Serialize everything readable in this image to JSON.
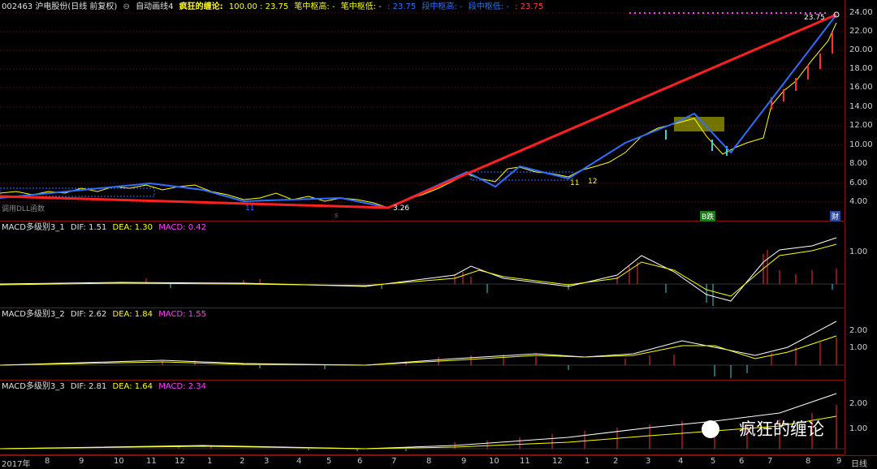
{
  "main": {
    "code_name": "002463 沪电股份(日线 前复权)",
    "indicator": "自动画线4",
    "highlight_label": "疯狂的缠论:",
    "highlight_value": "100.00 : 23.75",
    "bi_high_label": "笔中枢高: -",
    "bi_low_label": "笔中枢低: -",
    "bi_value": ": 23.75",
    "duan_high_label": "段中枢高: -",
    "duan_low_label": "段中枢低: -",
    "duan_value": ": 23.75",
    "price_last": "23.75",
    "price_low_label": "3.26",
    "label_11a": "11",
    "label_11b": "11",
    "label_12": "12",
    "dll_note": "调用DLL函数",
    "s_marker": "s",
    "chip_buy": "B跌",
    "chip_cai": "财",
    "y_ticks": [
      "24.00",
      "22.00",
      "20.00",
      "18.00",
      "16.00",
      "14.00",
      "12.00",
      "10.00",
      "8.00",
      "6.00",
      "4.00"
    ]
  },
  "macd1": {
    "name": "MACD多级别3_1",
    "dif": "DIF: 1.51",
    "dea": "DEA: 1.30",
    "macd": "MACD: 0.42",
    "tick": "1.00"
  },
  "macd2": {
    "name": "MACD多级别3_2",
    "dif": "DIF: 2.62",
    "dea": "DEA: 1.84",
    "macd": "MACD: 1.55",
    "ticks": [
      "2.00",
      "1.00"
    ]
  },
  "macd3": {
    "name": "MACD多级别3_3",
    "dif": "DIF: 2.81",
    "dea": "DEA: 1.64",
    "macd": "MACD: 2.34",
    "ticks": [
      "2.00",
      "1.00"
    ]
  },
  "bottom": {
    "year": "2017年",
    "months": [
      "8",
      "9",
      "10",
      "11",
      "12",
      "1",
      "2",
      "3",
      "4",
      "5",
      "6",
      "7",
      "8",
      "9",
      "10",
      "11",
      "12",
      "1",
      "2",
      "3",
      "4",
      "5",
      "6",
      "7",
      "8",
      "9"
    ],
    "period": "日线"
  },
  "watermark": "疯狂的缠论",
  "colors": {
    "red": "#ff2020",
    "blue": "#2f6fff",
    "yellow": "#ffff00",
    "magenta": "#ff40ff",
    "cyan": "#40d0d0"
  }
}
